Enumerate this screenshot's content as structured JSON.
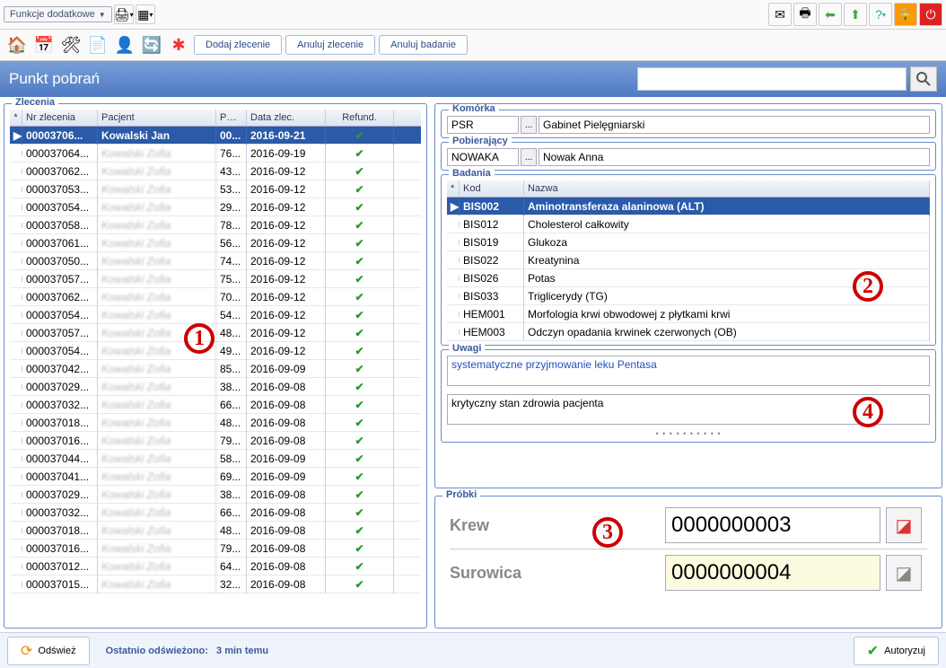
{
  "topbar": {
    "funkcje_label": "Funkcje dodatkowe"
  },
  "toolbar2": {
    "dodaj": "Dodaj zlecenie",
    "anuluj_zlecenie": "Anuluj zlecenie",
    "anuluj_badanie": "Anuluj badanie"
  },
  "title": "Punkt pobrań",
  "search": {
    "placeholder": ""
  },
  "zlecenia": {
    "legend": "Zlecenia",
    "cols": {
      "nr": "Nr zlecenia",
      "pacjent": "Pacjent",
      "pesel": "PESEL",
      "data": "Data zlec.",
      "refund": "Refund."
    },
    "rows": [
      {
        "nr": "00003706...",
        "pac": "Kowalski Jan",
        "pesel": "00...",
        "date": "2016-09-21",
        "sel": true
      },
      {
        "nr": "000037064...",
        "pac": "blurred",
        "pesel": "76...",
        "date": "2016-09-19"
      },
      {
        "nr": "000037062...",
        "pac": "blurred",
        "pesel": "43...",
        "date": "2016-09-12"
      },
      {
        "nr": "000037053...",
        "pac": "blurred",
        "pesel": "53...",
        "date": "2016-09-12"
      },
      {
        "nr": "000037054...",
        "pac": "blurred",
        "pesel": "29...",
        "date": "2016-09-12"
      },
      {
        "nr": "000037058...",
        "pac": "blurred",
        "pesel": "78...",
        "date": "2016-09-12"
      },
      {
        "nr": "000037061...",
        "pac": "blurred",
        "pesel": "56...",
        "date": "2016-09-12"
      },
      {
        "nr": "000037050...",
        "pac": "blurred",
        "pesel": "74...",
        "date": "2016-09-12"
      },
      {
        "nr": "000037057...",
        "pac": "blurred",
        "pesel": "75...",
        "date": "2016-09-12"
      },
      {
        "nr": "000037062...",
        "pac": "blurred",
        "pesel": "70...",
        "date": "2016-09-12"
      },
      {
        "nr": "000037054...",
        "pac": "blurred",
        "pesel": "54...",
        "date": "2016-09-12"
      },
      {
        "nr": "000037057...",
        "pac": "blurred",
        "pesel": "48...",
        "date": "2016-09-12"
      },
      {
        "nr": "000037054...",
        "pac": "blurred",
        "pesel": "49...",
        "date": "2016-09-12"
      },
      {
        "nr": "000037042...",
        "pac": "blurred",
        "pesel": "85...",
        "date": "2016-09-09"
      },
      {
        "nr": "000037029...",
        "pac": "blurred",
        "pesel": "38...",
        "date": "2016-09-08"
      },
      {
        "nr": "000037032...",
        "pac": "blurred",
        "pesel": "66...",
        "date": "2016-09-08"
      },
      {
        "nr": "000037018...",
        "pac": "blurred",
        "pesel": "48...",
        "date": "2016-09-08"
      },
      {
        "nr": "000037016...",
        "pac": "blurred",
        "pesel": "79...",
        "date": "2016-09-08"
      },
      {
        "nr": "000037044...",
        "pac": "blurred",
        "pesel": "58...",
        "date": "2016-09-09"
      },
      {
        "nr": "000037041...",
        "pac": "blurred",
        "pesel": "69...",
        "date": "2016-09-09"
      },
      {
        "nr": "000037029...",
        "pac": "blurred",
        "pesel": "38...",
        "date": "2016-09-08"
      },
      {
        "nr": "000037032...",
        "pac": "blurred",
        "pesel": "66...",
        "date": "2016-09-08"
      },
      {
        "nr": "000037018...",
        "pac": "blurred",
        "pesel": "48...",
        "date": "2016-09-08"
      },
      {
        "nr": "000037016...",
        "pac": "blurred",
        "pesel": "79...",
        "date": "2016-09-08"
      },
      {
        "nr": "000037012...",
        "pac": "blurred",
        "pesel": "64...",
        "date": "2016-09-08"
      },
      {
        "nr": "000037015...",
        "pac": "blurred",
        "pesel": "32...",
        "date": "2016-09-08"
      }
    ]
  },
  "komorka": {
    "legend": "Komórka",
    "code": "PSR",
    "name": "Gabinet Pielęgniarski"
  },
  "pobierajacy": {
    "legend": "Pobierający",
    "code": "NOWAKA",
    "name": "Nowak Anna"
  },
  "badania": {
    "legend": "Badania",
    "cols": {
      "kod": "Kod",
      "nazwa": "Nazwa"
    },
    "rows": [
      {
        "kod": "BIS002",
        "nazwa": "Aminotransferaza alaninowa (ALT)",
        "sel": true
      },
      {
        "kod": "BIS012",
        "nazwa": "Cholesterol całkowity"
      },
      {
        "kod": "BIS019",
        "nazwa": "Glukoza"
      },
      {
        "kod": "BIS022",
        "nazwa": "Kreatynina"
      },
      {
        "kod": "BIS026",
        "nazwa": "Potas"
      },
      {
        "kod": "BIS033",
        "nazwa": "Triglicerydy (TG)"
      },
      {
        "kod": "HEM001",
        "nazwa": "Morfologia krwi obwodowej z płytkami krwi"
      },
      {
        "kod": "HEM003",
        "nazwa": "Odczyn opadania krwinek czerwonych (OB)"
      }
    ]
  },
  "uwagi": {
    "legend": "Uwagi",
    "note1": "systematyczne przyjmowanie leku Pentasa",
    "note2": "krytyczny stan zdrowia pacjenta"
  },
  "probki": {
    "legend": "Próbki",
    "samples": [
      {
        "label": "Krew",
        "value": "0000000003",
        "yellow": false
      },
      {
        "label": "Surowica",
        "value": "0000000004",
        "yellow": true
      }
    ]
  },
  "footer": {
    "odswiez": "Odśwież",
    "status_label": "Ostatnio odświeżono:",
    "status_val": "3 min temu",
    "autoryzuj": "Autoryzuj"
  },
  "annotations": [
    "1",
    "2",
    "3",
    "4"
  ]
}
